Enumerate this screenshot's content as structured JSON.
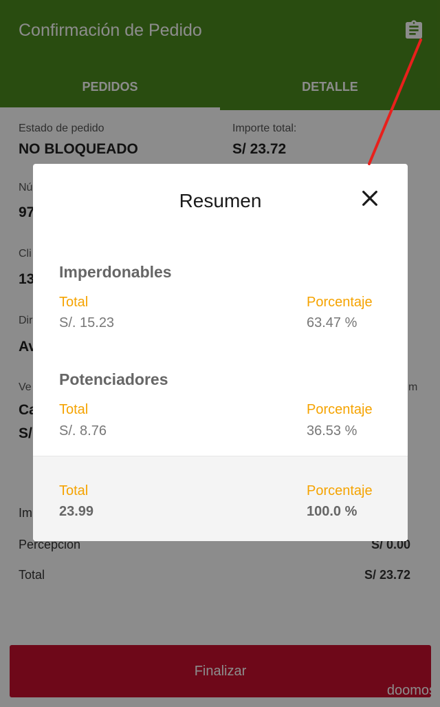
{
  "appbar": {
    "title": "Confirmación de Pedido",
    "icon": "clipboard-icon",
    "color": "#4c8a1e"
  },
  "tabs": [
    {
      "label": "PEDIDOS",
      "selected": true
    },
    {
      "label": "DETALLE",
      "selected": false
    }
  ],
  "order": {
    "estado_label": "Estado de pedido",
    "estado_value": "NO BLOQUEADO",
    "importe_label": "Importe total:",
    "importe_value": "S/  23.72",
    "numero_label": "Nú",
    "numero_value": "97",
    "cliente_label": "Cli",
    "cliente_value": "13",
    "direccion_label": "Dir",
    "direccion_value": "Av",
    "vendedor_label": "Ve",
    "vendedor_value": "Ca",
    "vendedor_extra": "S/",
    "right_partial": "m"
  },
  "summary": {
    "importe_label": "Im",
    "importe_value": "",
    "percepcion_label": "Percepción",
    "percepcion_value": "S/  0.00",
    "total_label": "Total",
    "total_value": "S/  23.72"
  },
  "finalizar_label": "Finalizar",
  "finalizar_color": "#c8102e",
  "watermark": "doomos",
  "dialog": {
    "title": "Resumen",
    "close_icon": "close-icon",
    "sections": [
      {
        "title": "Imperdonables",
        "total_label": "Total",
        "total_value": "S/. 15.23",
        "pct_label": "Porcentaje",
        "pct_value": "63.47 %"
      },
      {
        "title": "Potenciadores",
        "total_label": "Total",
        "total_value": "S/. 8.76",
        "pct_label": "Porcentaje",
        "pct_value": "36.53 %"
      }
    ],
    "footer": {
      "total_label": "Total",
      "total_value": "23.99",
      "pct_label": "Porcentaje",
      "pct_value": "100.0 %"
    },
    "accent_color": "#f5a300"
  }
}
